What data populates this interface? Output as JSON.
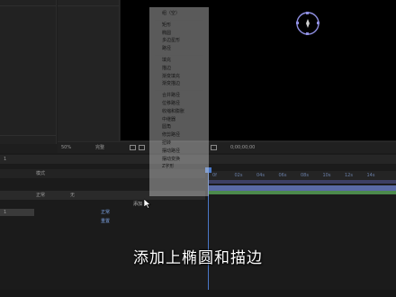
{
  "viewer_bar": {
    "zoom": "50%",
    "resolution": "完整",
    "timecode": "0;00;00;00"
  },
  "timeline": {
    "tab_label": "1",
    "mode_header": "模式",
    "mode_value": "正常",
    "mode_value_2": "无",
    "sub_label": "1",
    "add_label": "添加",
    "annotation_1": "正常",
    "annotation_2": "重置",
    "ruler_ticks": [
      "0f",
      "02s",
      "04s",
      "06s",
      "08s",
      "10s",
      "12s",
      "14s"
    ]
  },
  "shape_menu": {
    "groups": [
      [
        "组（空）"
      ],
      [
        "矩形",
        "椭圆",
        "多边星形",
        "路径"
      ],
      [
        "填充",
        "描边",
        "渐变填充",
        "渐变描边"
      ],
      [
        "合并路径",
        "位移路径",
        "收缩和膨胀",
        "中继器",
        "圆角",
        "修剪路径",
        "扭转",
        "摆动路径",
        "摆动变换",
        "Z字形"
      ]
    ]
  },
  "subtitle": "添加上椭圆和描边",
  "colors": {
    "accent": "#4a78c8",
    "track": "#5a6aa5",
    "green": "#4c8a4c"
  }
}
